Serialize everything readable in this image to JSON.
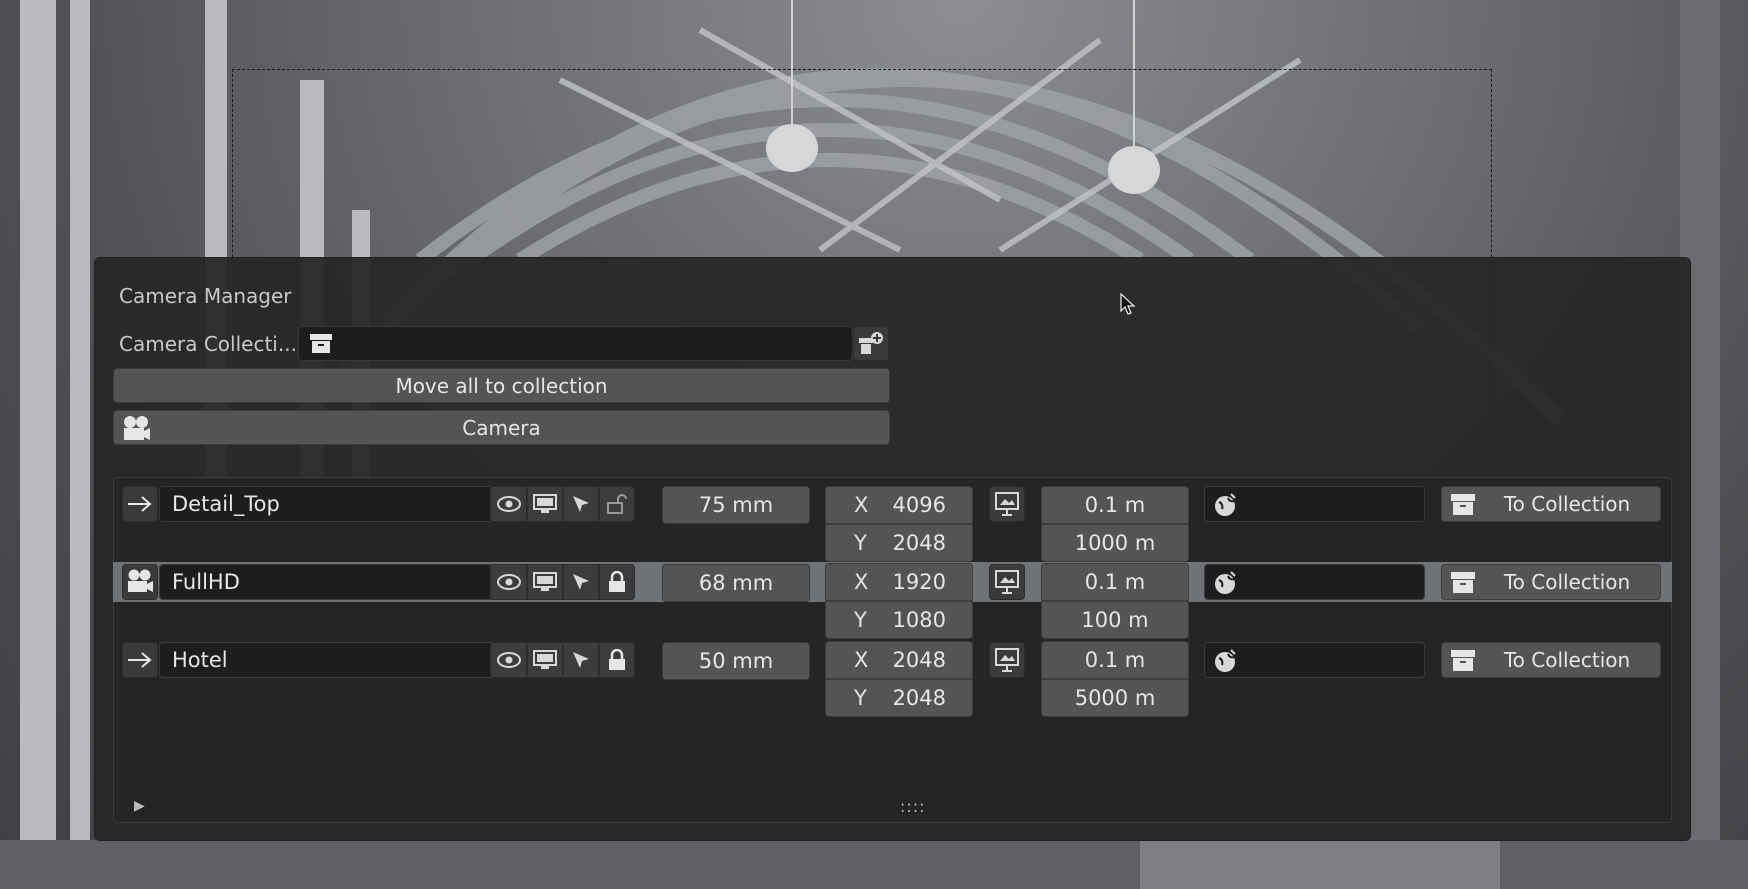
{
  "panel": {
    "title": "Camera Manager",
    "collection_label": "Camera Collecti...",
    "collection_value": "",
    "move_all_label": "Move all to collection",
    "camera_button_label": "Camera"
  },
  "cameras": [
    {
      "name": "Detail_Top",
      "row_icon": "arrow-right-icon",
      "locked": false,
      "lens": "75 mm",
      "res_x_axis": "X",
      "res_x": "4096",
      "res_y_axis": "Y",
      "res_y": "2048",
      "clip_start": "0.1 m",
      "clip_end": "1000 m",
      "world": "",
      "to_collection_label": "To Collection",
      "active": false
    },
    {
      "name": "FullHD",
      "row_icon": "camera-icon",
      "locked": true,
      "lens": "68 mm",
      "res_x_axis": "X",
      "res_x": "1920",
      "res_y_axis": "Y",
      "res_y": "1080",
      "clip_start": "0.1 m",
      "clip_end": "100 m",
      "world": "",
      "to_collection_label": "To Collection",
      "active": true
    },
    {
      "name": "Hotel",
      "row_icon": "arrow-right-icon",
      "locked": true,
      "lens": "50 mm",
      "res_x_axis": "X",
      "res_x": "2048",
      "res_y_axis": "Y",
      "res_y": "2048",
      "clip_start": "0.1 m",
      "clip_end": "5000 m",
      "world": "",
      "to_collection_label": "To Collection",
      "active": false
    }
  ],
  "footer": {
    "expand_glyph": "▶",
    "grip_glyph": "::::"
  },
  "colors": {
    "panel_bg": "#262626",
    "button": "#545454",
    "active_row": "#6f7276",
    "field": "#1d1d1d"
  }
}
